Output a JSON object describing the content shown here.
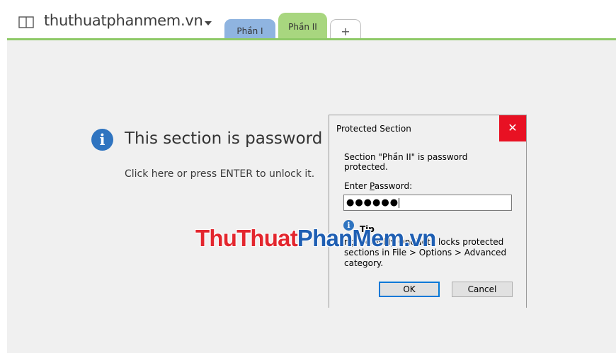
{
  "notebook": {
    "name": "thuthuatphanmem.vn",
    "icon": "notebook-icon"
  },
  "tabs": [
    {
      "label": "Phần I",
      "color": "#8fb4e0"
    },
    {
      "label": "Phần II",
      "color": "#a8d67f",
      "active": true
    }
  ],
  "add_tab_label": "+",
  "page": {
    "info_icon_glyph": "i",
    "title": "This section is password p",
    "hint": "Click here or press ENTER to unlock it."
  },
  "dialog": {
    "title": "Protected Section",
    "close_glyph": "✕",
    "message": "Section \"Phần II\" is password protected.",
    "password_label_pre": "Enter ",
    "password_label_underlined": "P",
    "password_label_post": "assword:",
    "password_value": "●●●●●●",
    "tip_glyph": "i",
    "tip_label": "Tip",
    "tip_text": "ng    v quickly OneNote locks protected sections in File > Options > Advanced category.",
    "ok_label": "OK",
    "cancel_label": "Cancel"
  },
  "watermark": {
    "part1": "ThuThuat",
    "part2": "PhanMem.vn"
  },
  "colors": {
    "accent_green": "#8fc968",
    "close_red": "#e81123",
    "info_blue": "#2f74c0",
    "button_focus": "#0078d7"
  }
}
